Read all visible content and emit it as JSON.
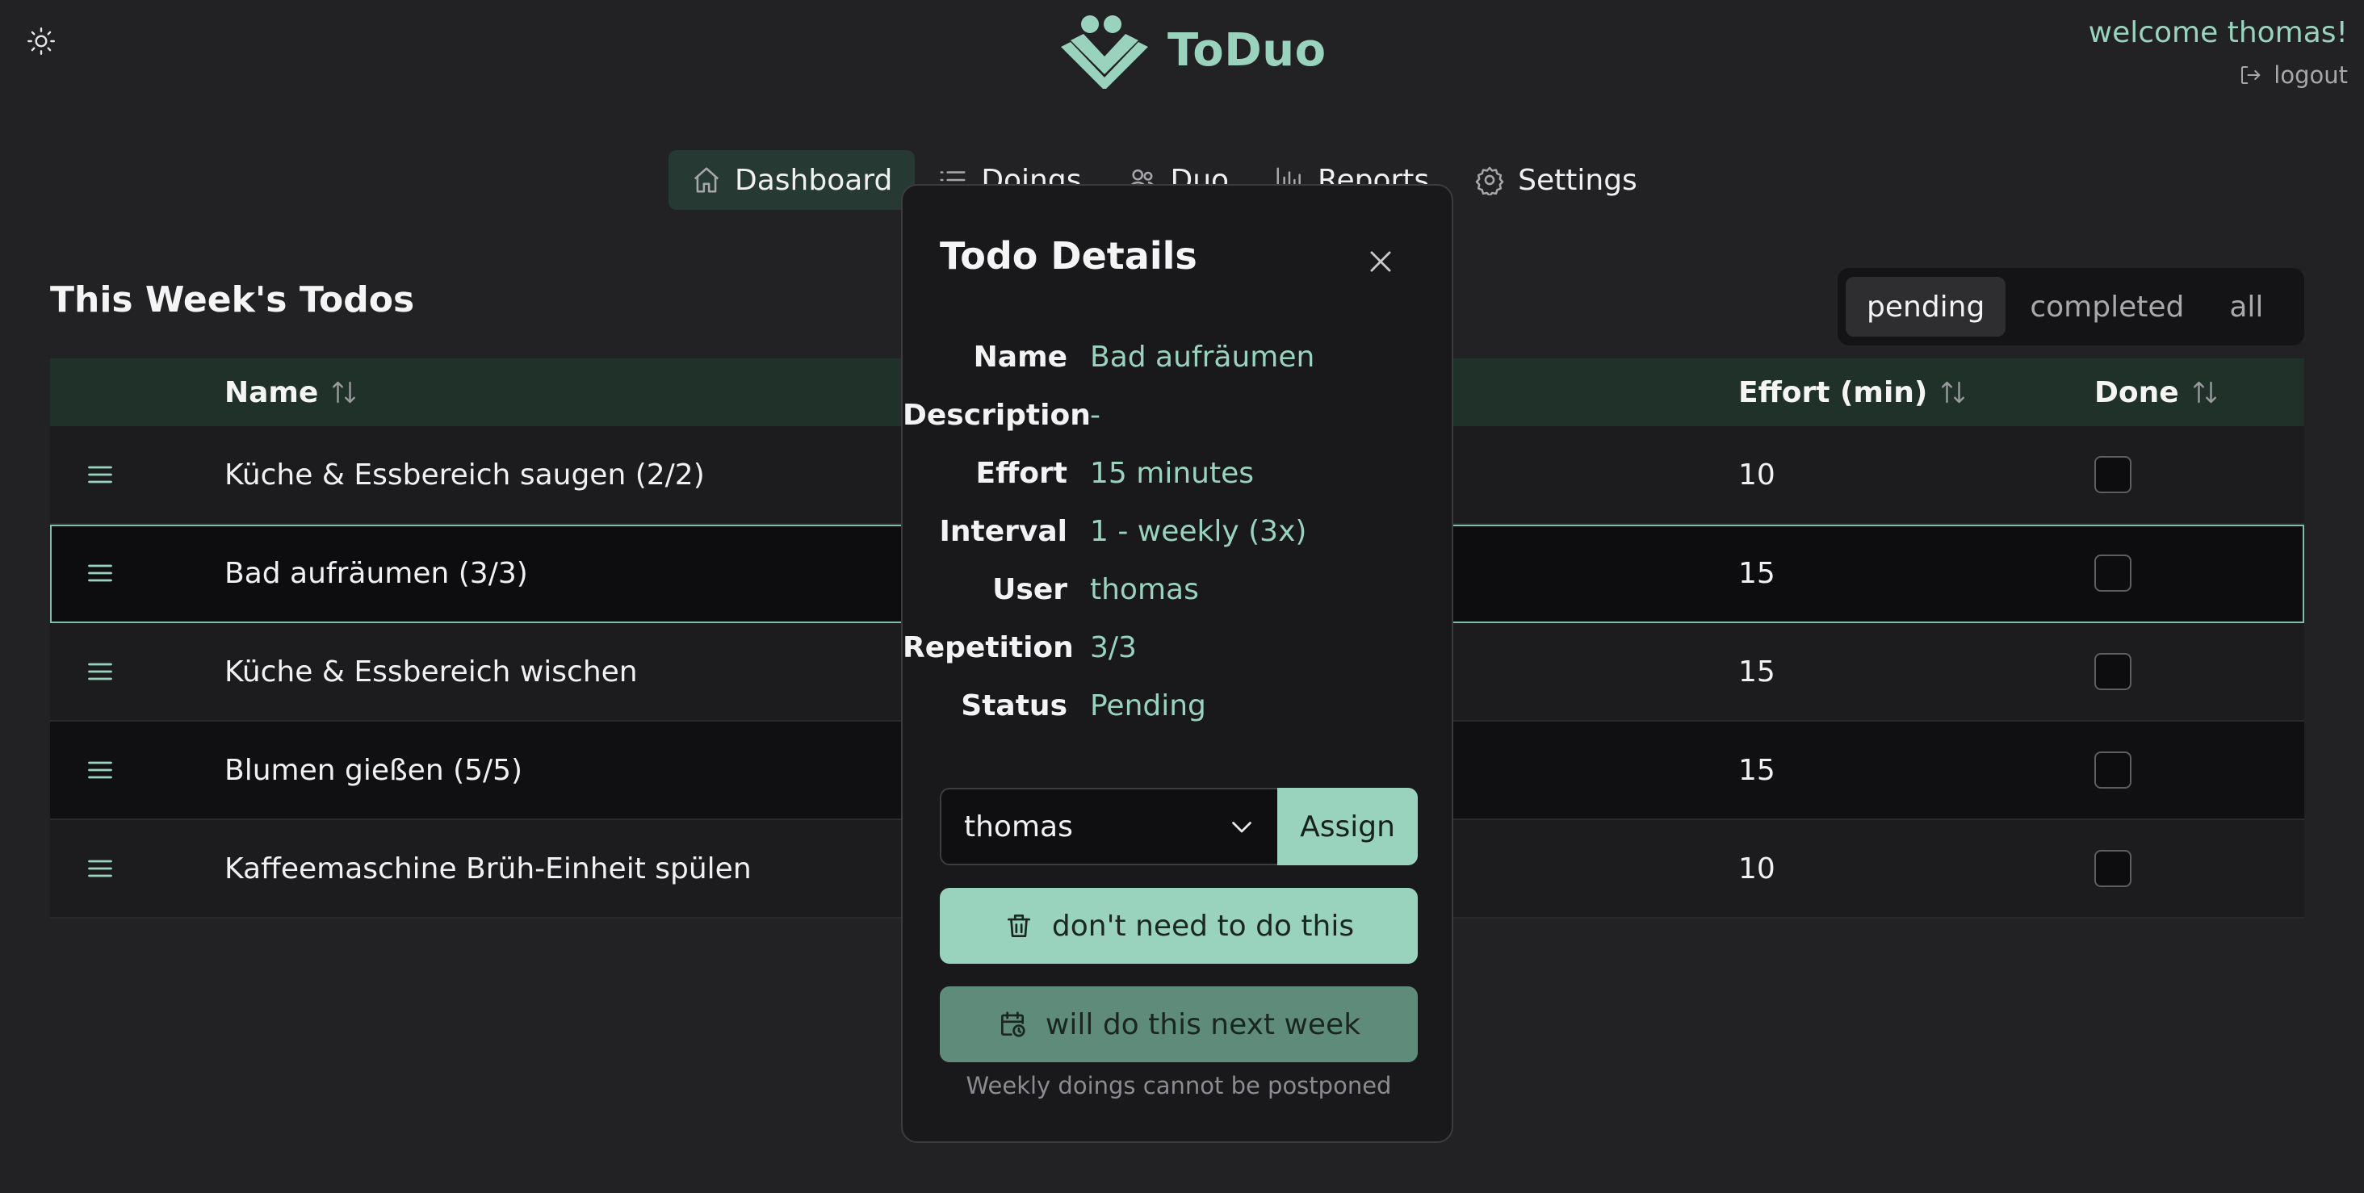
{
  "app": {
    "name": "ToDuo"
  },
  "user": {
    "welcome": "welcome thomas!",
    "logout_label": "logout"
  },
  "nav": [
    {
      "label": "Dashboard",
      "icon": "home-icon",
      "active": true
    },
    {
      "label": "Doings",
      "icon": "list-icon",
      "active": false
    },
    {
      "label": "Duo",
      "icon": "users-icon",
      "active": false
    },
    {
      "label": "Reports",
      "icon": "bar-chart-icon",
      "active": false
    },
    {
      "label": "Settings",
      "icon": "gear-icon",
      "active": false
    }
  ],
  "page": {
    "title": "This Week's Todos"
  },
  "filters": [
    {
      "label": "pending",
      "active": true
    },
    {
      "label": "completed",
      "active": false
    },
    {
      "label": "all",
      "active": false
    }
  ],
  "table": {
    "columns": {
      "name": "Name",
      "effort": "Effort (min)",
      "done": "Done"
    },
    "rows": [
      {
        "name": "Küche & Essbereich saugen (2/2)",
        "effort": "10",
        "done": false
      },
      {
        "name": "Bad aufräumen (3/3)",
        "effort": "15",
        "done": false,
        "selected": true
      },
      {
        "name": "Küche & Essbereich wischen",
        "effort": "15",
        "done": false
      },
      {
        "name": "Blumen gießen (5/5)",
        "effort": "15",
        "done": false
      },
      {
        "name": "Kaffeemaschine Brüh-Einheit spülen",
        "effort": "10",
        "done": false
      }
    ]
  },
  "modal": {
    "title": "Todo Details",
    "details": [
      {
        "label": "Name",
        "value": "Bad aufräumen"
      },
      {
        "label": "Description",
        "value": "-"
      },
      {
        "label": "Effort",
        "value": "15 minutes"
      },
      {
        "label": "Interval",
        "value": "1 - weekly (3x)"
      },
      {
        "label": "User",
        "value": "thomas"
      },
      {
        "label": "Repetition",
        "value": "3/3"
      },
      {
        "label": "Status",
        "value": "Pending"
      }
    ],
    "assign_select_value": "thomas",
    "assign_label": "Assign",
    "skip_label": "don't need to do this",
    "postpone_label": "will do this next week",
    "postpone_note": "Weekly doings cannot be postponed"
  },
  "colors": {
    "accent": "#9ad3bd",
    "background": "#222224",
    "header_row": "#203129",
    "postpone_button": "#5f8b7b"
  }
}
